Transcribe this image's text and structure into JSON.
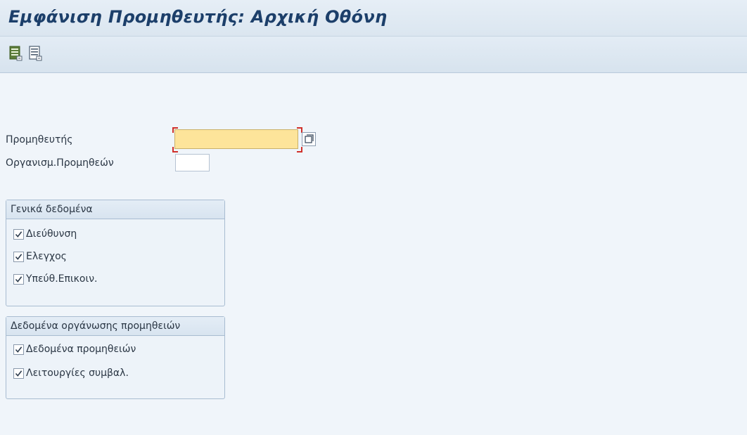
{
  "window": {
    "title": "Εμφάνιση Προμηθευτής: Αρχική Οθόνη"
  },
  "toolbar": {
    "buttons": [
      {
        "icon": "document-list-icon",
        "tooltip": ""
      },
      {
        "icon": "document-icon",
        "tooltip": ""
      }
    ]
  },
  "form": {
    "vendor": {
      "label": "Προμηθευτής",
      "value": "",
      "required": true
    },
    "purch_org": {
      "label": "Οργανισμ.Προμηθεών",
      "value": ""
    }
  },
  "groups": {
    "general": {
      "title": "Γενικά δεδομένα",
      "items": [
        {
          "label": "Διεύθυνση",
          "checked": true
        },
        {
          "label": "Ελεγχος",
          "checked": true
        },
        {
          "label": "Υπεύθ.Επικοιν.",
          "checked": true
        }
      ]
    },
    "purch_org_data": {
      "title": "Δεδομένα οργάνωσης προμηθειών",
      "items": [
        {
          "label": "Δεδομένα προμηθειών",
          "checked": true
        },
        {
          "label": "Λειτουργίες συμβαλ.",
          "checked": true
        }
      ]
    }
  },
  "colors": {
    "title": "#1c3f6a",
    "required_field": "#fde49a",
    "required_marker": "#d0302a",
    "background": "#f0f5fa"
  }
}
